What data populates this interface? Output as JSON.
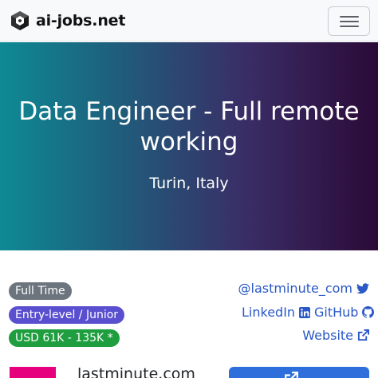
{
  "navbar": {
    "brand": "ai-jobs.net",
    "menu_icon": "hamburger-menu-icon"
  },
  "hero": {
    "title": "Data Engineer - Full remote working",
    "location": "Turin, Italy",
    "gradient_colors": [
      "#0e8a94",
      "#1e5f7c",
      "#3a2d66",
      "#2b0a37"
    ]
  },
  "badges": {
    "employment_type": "Full Time",
    "level": "Entry-level / Junior",
    "salary": "USD 61K - 135K *"
  },
  "links": {
    "twitter": "@lastminute_com",
    "linkedin": "LinkedIn",
    "github": "GitHub",
    "website": "Website"
  },
  "company": {
    "name": "lastminute.com",
    "logo_color": "#e6007e"
  },
  "apply": {
    "icon": "external-link-icon"
  },
  "colors": {
    "link": "#2a58c6",
    "badge_gray": "#6c757d",
    "badge_purple": "#5a4fcf",
    "badge_green": "#1e9e3e",
    "button": "#2f6fdc"
  }
}
